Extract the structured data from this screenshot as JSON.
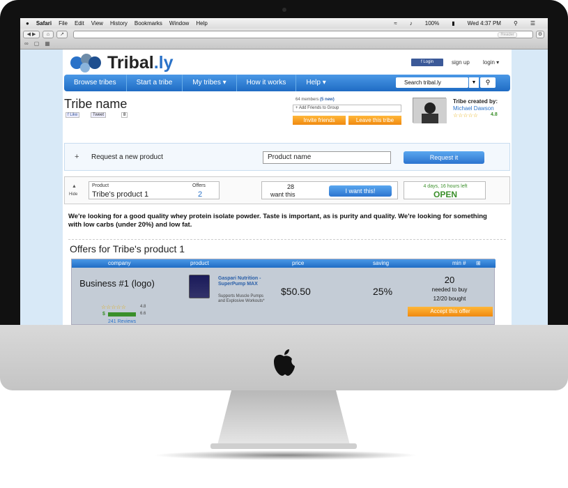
{
  "menubar": {
    "apple": "",
    "items": [
      "Safari",
      "File",
      "Edit",
      "View",
      "History",
      "Bookmarks",
      "Window",
      "Help"
    ],
    "battery": "100%",
    "clock": "Wed 4:37 PM"
  },
  "toolbar": {
    "reader": "Reader"
  },
  "site": {
    "logo_main": "Tribal",
    "logo_suffix": ".ly",
    "fb_login": "Login",
    "signup": "sign up",
    "login": "login"
  },
  "nav": {
    "items": [
      "Browse tribes",
      "Start a tribe",
      "My tribes",
      "How it works",
      "Help"
    ],
    "search_placeholder": "Search tribal.ly"
  },
  "tribe": {
    "name": "Tribe name",
    "like": "Like",
    "tweet": "Tweet",
    "tweet_count": "8",
    "members": "64 members",
    "members_new": "(5 new)",
    "add_friends": "+ Add Friends to Group",
    "invite": "Invite friends",
    "leave": "Leave this tribe",
    "creator_label": "Tribe created by:",
    "creator_name": "Michael Dawson",
    "creator_stars": "☆☆☆☆☆",
    "creator_rating": "4.8"
  },
  "request": {
    "label": "Request a new product",
    "input_value": "Product name",
    "button": "Request it"
  },
  "product": {
    "hide": "Hide",
    "product_head": "Product",
    "offers_head": "Offers",
    "product_name": "Tribe's product 1",
    "offers_count": "2",
    "want_count": "28",
    "want_label": "want this",
    "want_button": "I want this!",
    "time_left": "4 days, 16 hours left",
    "status": "OPEN",
    "description": "We're looking for a good quality whey protein isolate powder. Taste is important, as is purity and quality. We're looking for something with low carbs (under 20%) and low fat."
  },
  "offers": {
    "title": "Offers for Tribe's product 1",
    "columns": [
      "company",
      "product",
      "price",
      "saving",
      "min #"
    ],
    "rows": [
      {
        "company": "Business #1 (logo)",
        "stars": "☆☆☆☆☆",
        "rating": "4.8",
        "value_rating": "6.6",
        "reviews": "241 Reviews",
        "product_name": "Gaspari Nutrition - SuperPump MAX",
        "product_desc": "Supports Muscle Pumps and Explosive Workouts*",
        "price": "$50.50",
        "saving": "25%",
        "min": "20",
        "min_label": "needed to buy",
        "bought": "12/20 bought",
        "accept": "Accept this offer"
      }
    ]
  }
}
